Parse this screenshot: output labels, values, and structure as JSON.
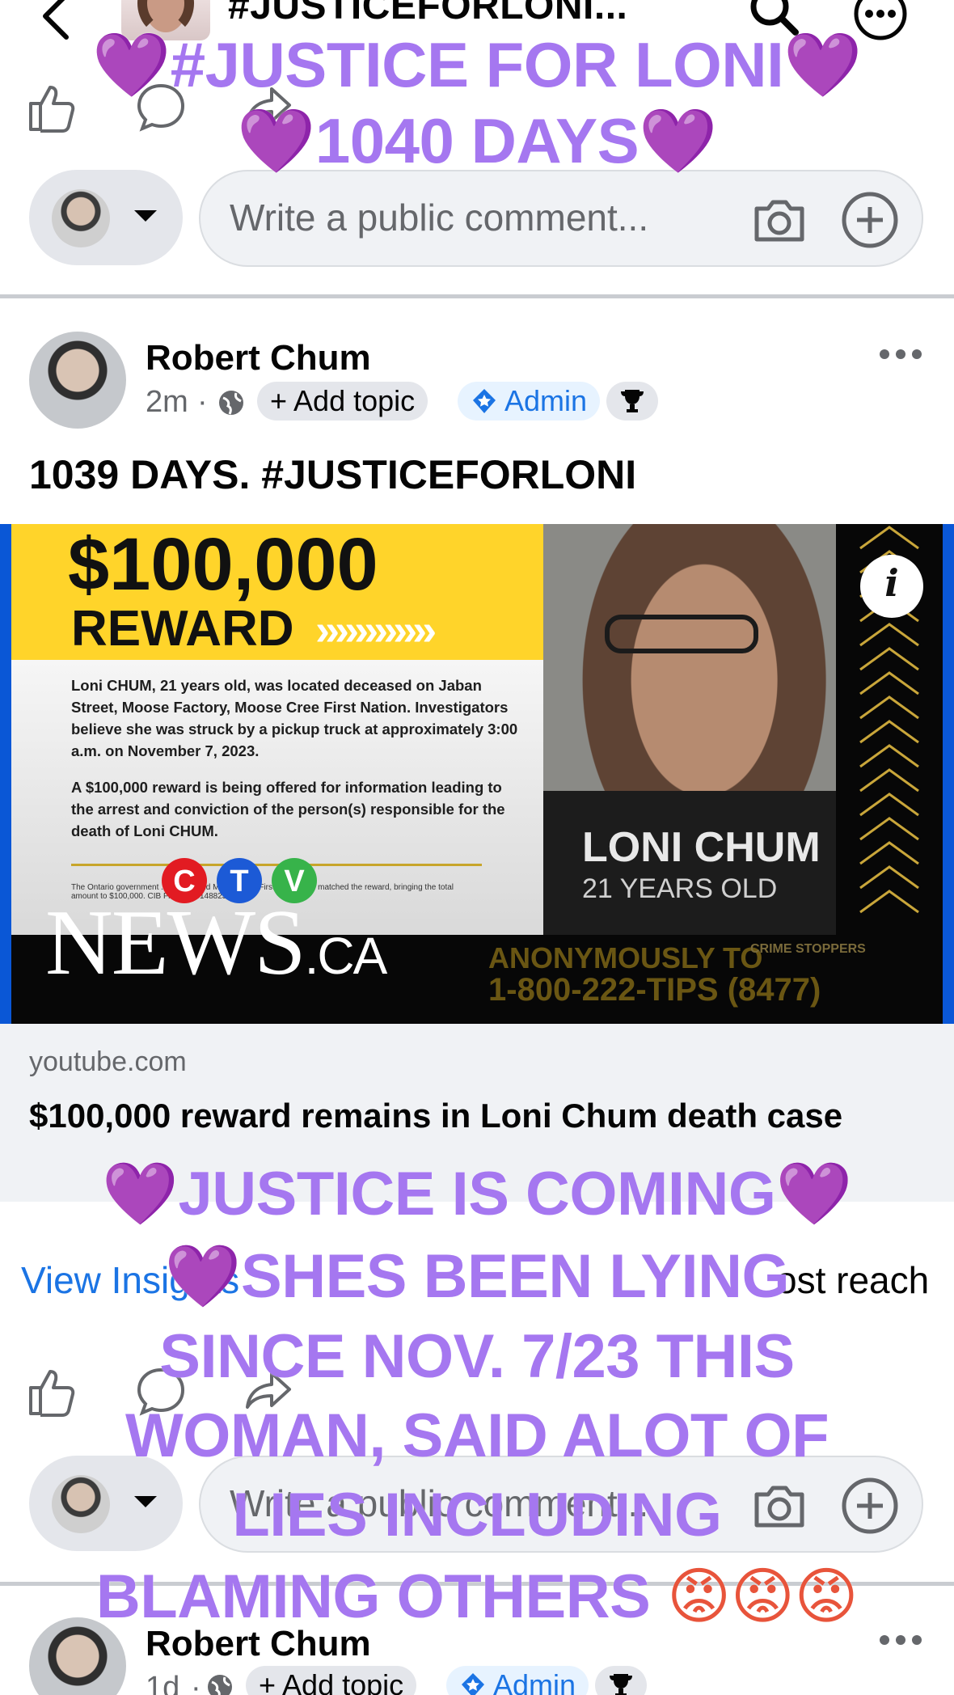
{
  "header": {
    "group_title": "#JUSTICEFORLONI..."
  },
  "comment_box": {
    "placeholder": "Write a public comment...",
    "placeholder_partial": "Write a public comment..."
  },
  "post1": {
    "author": "Robert Chum",
    "time": "2m",
    "separator": "·",
    "add_topic": "+ Add topic",
    "admin_badge": "Admin",
    "text": "1039 DAYS. #JUSTICEFORLONI",
    "link": {
      "domain": "youtube.com",
      "title": "$100,000 reward remains in Loni Chum death case"
    },
    "view_insights": "View Insights",
    "boost_reach": "ost reach"
  },
  "preview_image": {
    "amount": "$100,000",
    "reward": "REWARD",
    "arrows": "»»»»»»",
    "body_paragraph_1": "Loni CHUM, 21 years old, was located deceased on Jaban Street, Moose Factory, Moose Cree First Nation. Investigators believe she was struck by a pickup truck at approximately 3:00 a.m. on November 7, 2023.",
    "body_paragraph_2": "A $100,000 reward is being offered for information leading to the arrest and conviction of the person(s) responsible for the death of Loni CHUM.",
    "fine_print": "The Ontario government ... reward and Moose Cree First Nation has matched the reward, bringing the total amount to $100,000. CIB File # E231488236",
    "name": "LONI CHUM",
    "age": "21 YEARS OLD",
    "anonymously": "ANONYMOUSLY TO",
    "tips_line": "1-800-222-TIPS (8477)",
    "crime_stoppers": "CRIME STOPPERS",
    "info_glyph": "i",
    "ctv_letters": [
      "C",
      "T",
      "V"
    ],
    "news_logo_main": "NEWS",
    "news_logo_suffix": ".CA"
  },
  "post2": {
    "author": "Robert Chum",
    "time": "1d",
    "separator": "·",
    "add_topic": "+ Add topic",
    "admin_badge": "Admin"
  },
  "overlay_top": {
    "heart": "💜",
    "line1": "#JUSTICE FOR LONI",
    "line2": "1040 DAYS"
  },
  "overlay_bottom": {
    "heart": "💜",
    "line1": "JUSTICE IS COMING",
    "line2": "SHES BEEN LYING",
    "line3": "SINCE NOV. 7/23 THIS",
    "line4": "WOMAN, SAID ALOT OF",
    "line5": "LIES INCLUDING",
    "line6": "BLAMING OTHERS",
    "angry_emoji": "😡"
  },
  "icons": {
    "back": "chevron-left-icon",
    "search": "search-icon",
    "more": "more-horizontal-icon",
    "like": "thumbs-up-icon",
    "comment": "comment-bubble-icon",
    "share": "share-icon",
    "camera": "camera-icon",
    "add": "plus-circle-icon",
    "globe": "globe-icon",
    "admin": "shield-star-icon",
    "trophy": "trophy-icon",
    "caret": "caret-down-icon"
  },
  "colors": {
    "facebook_blue": "#1b74e4",
    "overlay_purple": "#a577f0",
    "divider": "#c9ccd1",
    "reward_yellow": "#ffd42a",
    "frame_blue": "#0a57d6"
  }
}
